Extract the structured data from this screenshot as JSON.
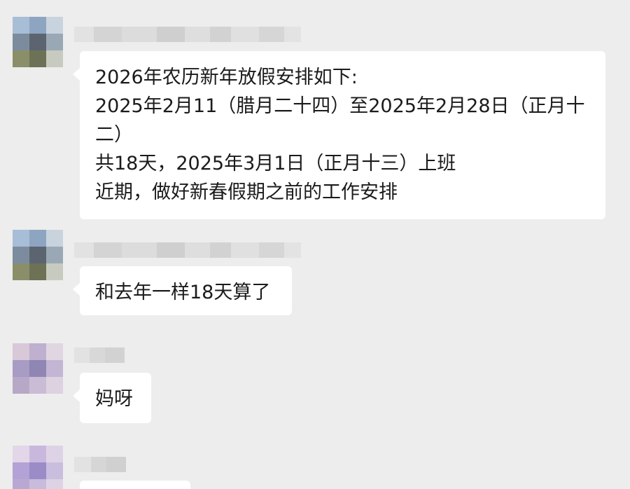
{
  "messages": [
    {
      "sender": "",
      "avatar_color": "#6e7d8c",
      "lines": [
        "2026年农历新年放假安排如下:",
        "2025年2月11（腊月二十四）至2025年2月28日（正月十二）",
        "共18天，2025年3月1日（正月十三）上班",
        "近期，做好新春假期之前的工作安排"
      ]
    },
    {
      "sender": "",
      "avatar_color": "#6e7d8c",
      "lines": [
        "和去年一样18天算了"
      ]
    },
    {
      "sender": "",
      "avatar_color": "#b9a9c8",
      "lines": [
        "妈呀"
      ]
    },
    {
      "sender": "",
      "avatar_color": "#c4b2d9",
      "lines": []
    }
  ]
}
